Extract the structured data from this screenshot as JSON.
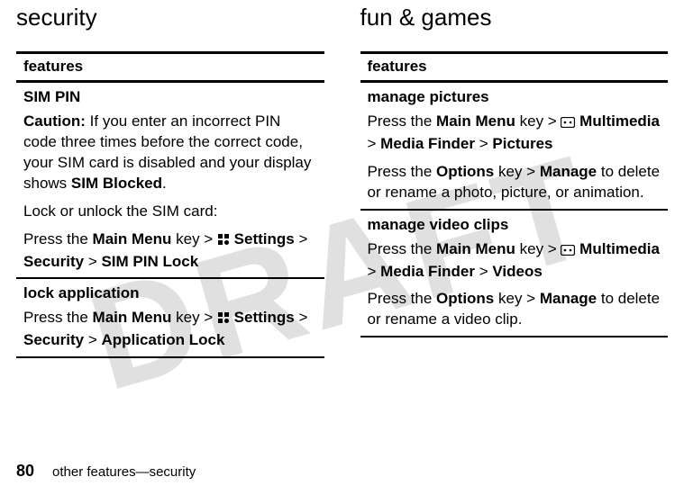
{
  "watermark": "DRAFT",
  "left": {
    "heading": "security",
    "table_header": "features",
    "rows": [
      {
        "title": "SIM PIN",
        "caution_label": "Caution:",
        "caution_text": " If you enter an incorrect PIN code three times before the correct code, your SIM card is disabled and your display shows ",
        "caution_trail_ui": "SIM Blocked",
        "caution_period": ".",
        "line2": "Lock or unlock the SIM card:",
        "p3_a": "Press the ",
        "p3_mainmenu": "Main Menu",
        "p3_b": " key > ",
        "p3_icon": "settings-icon",
        "p3_settings": " Settings",
        "p3_c": " > ",
        "p3_security": "Security",
        "p3_d": " > ",
        "p3_simpin": "SIM PIN Lock"
      },
      {
        "title": "lock application",
        "p1_a": "Press the ",
        "p1_mainmenu": "Main Menu",
        "p1_b": " key > ",
        "p1_icon": "settings-icon",
        "p1_settings": " Settings",
        "p1_c": " > ",
        "p1_security": "Security",
        "p1_d": " > ",
        "p1_applock": "Application Lock"
      }
    ]
  },
  "right": {
    "heading": "fun & games",
    "table_header": "features",
    "rows": [
      {
        "title": "manage pictures",
        "p1_a": "Press the ",
        "p1_mainmenu": "Main Menu",
        "p1_b": " key > ",
        "p1_icon": "multimedia-icon",
        "p1_mm": " Multimedia",
        "p1_c": " > ",
        "p1_mf": "Media Finder",
        "p1_d": " > ",
        "p1_pic": "Pictures",
        "p2_a": "Press the ",
        "p2_options": "Options",
        "p2_b": " key > ",
        "p2_manage": "Manage",
        "p2_c": " to delete or rename a photo, picture, or animation."
      },
      {
        "title": "manage video clips",
        "p1_a": "Press the ",
        "p1_mainmenu": "Main Menu",
        "p1_b": " key > ",
        "p1_icon": "multimedia-icon",
        "p1_mm": " Multimedia",
        "p1_c": " > ",
        "p1_mf": "Media Finder",
        "p1_d": " > ",
        "p1_vid": "Videos",
        "p2_a": "Press the ",
        "p2_options": "Options",
        "p2_b": " key > ",
        "p2_manage": "Manage",
        "p2_c": " to delete or rename a video clip."
      }
    ]
  },
  "footer": {
    "page_number": "80",
    "breadcrumb": "other features—security"
  }
}
